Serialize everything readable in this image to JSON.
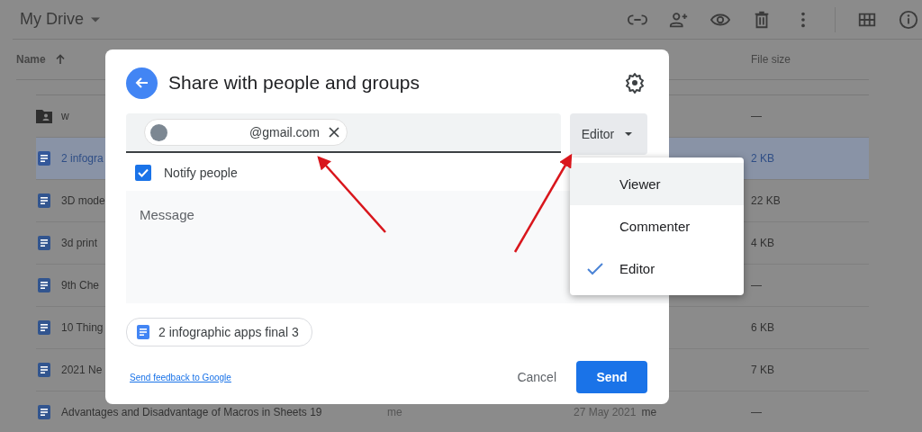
{
  "top_bar": {
    "title": "My Drive"
  },
  "file_list": {
    "columns": [
      {
        "label": "Name",
        "sorted": true
      },
      {
        "label": "File size"
      }
    ],
    "rows": [
      {
        "kind": "folder",
        "name": "w",
        "size": "—",
        "selected": false
      },
      {
        "kind": "doc",
        "name": "2 infogra",
        "size": "2 KB",
        "selected": true
      },
      {
        "kind": "doc",
        "name": "3D mode",
        "size": "22 KB",
        "selected": false
      },
      {
        "kind": "doc",
        "name": "3d print",
        "size": "4 KB",
        "selected": false
      },
      {
        "kind": "doc",
        "name": "9th Che",
        "size": "—",
        "selected": false
      },
      {
        "kind": "doc",
        "name": "10 Thing",
        "size": "6 KB",
        "selected": false
      },
      {
        "kind": "doc",
        "name": "2021 Ne",
        "size": "7 KB",
        "selected": false
      },
      {
        "kind": "doc",
        "name": "Advantages and Disadvantage of Macros in Sheets 19",
        "owner": "me",
        "modified": "27 May 2021",
        "modified_by": "me",
        "size": "—",
        "selected": false
      }
    ]
  },
  "share_dialog": {
    "title": "Share with people and groups",
    "recipient": {
      "email": "@gmail.com"
    },
    "role_button": "Editor",
    "notify": {
      "label": "Notify people",
      "checked": true
    },
    "message": {
      "placeholder": "Message"
    },
    "attachment": "2 infographic apps final 3",
    "feedback_link": "Send feedback to Google",
    "buttons": [
      {
        "label": "Cancel",
        "kind": "text"
      },
      {
        "label": "Send",
        "kind": "primary"
      }
    ]
  },
  "role_menu": {
    "items": [
      {
        "label": "Viewer",
        "selected": false,
        "hovered": true
      },
      {
        "label": "Commenter",
        "selected": false,
        "hovered": false
      },
      {
        "label": "Editor",
        "selected": true,
        "hovered": false
      }
    ]
  }
}
